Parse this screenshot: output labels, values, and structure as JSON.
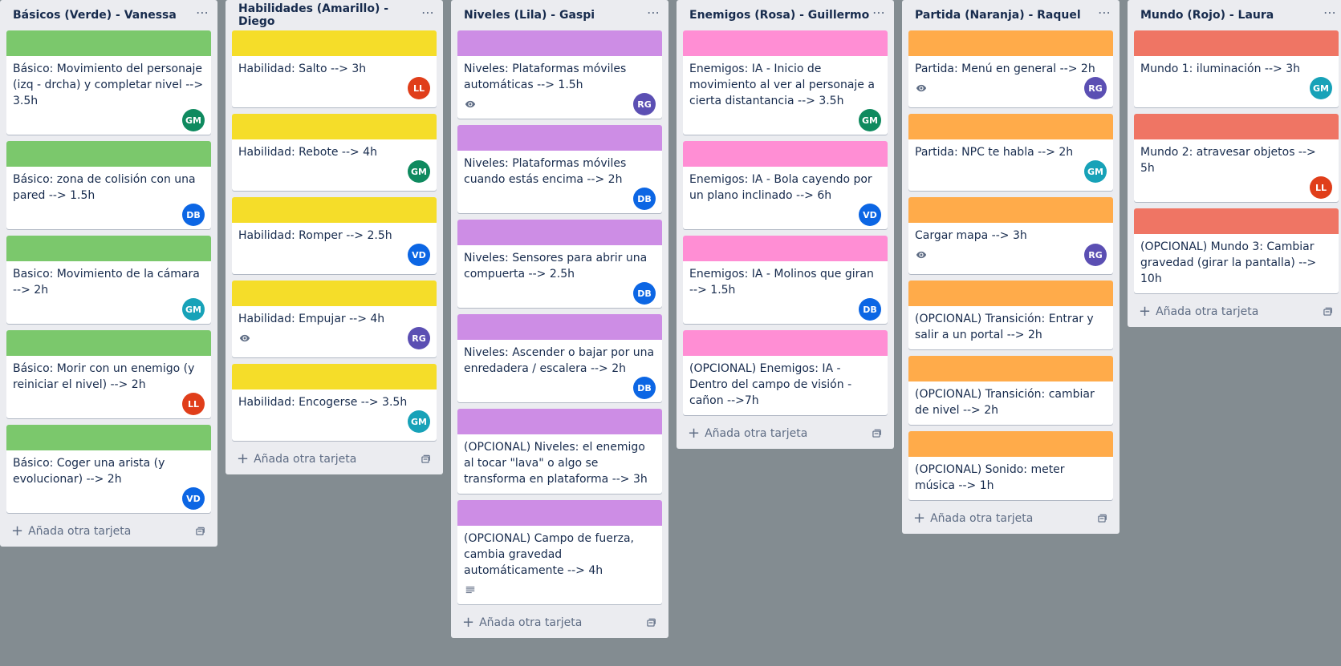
{
  "colors": {
    "green": "#61bd4f",
    "yellow": "#f2d600",
    "purple": "#c377e0",
    "pink": "#ff78cb",
    "orange": "#ff9f1a",
    "red": "#eb5a46"
  },
  "avatar_colors": {
    "GM": "#0f8a5f",
    "DB": "#0c66e4",
    "LL": "#e03e1a",
    "VD": "#0c66e4",
    "RG": "#5b4fb3"
  },
  "add_card_label": "Añada otra tarjeta",
  "lists": [
    {
      "title": "Básicos (Verde) - Vanessa",
      "color": "#7bc86c",
      "cards": [
        {
          "title": "Básico: Movimiento del personaje (izq - drcha) y completar nivel --> 3.5h",
          "member": "GM",
          "member_color": "#0f8a5f"
        },
        {
          "title": "Básico: zona de colisión con una pared --> 1.5h",
          "member": "DB",
          "member_color": "#0c66e4"
        },
        {
          "title": "Basico: Movimiento de la cámara --> 2h",
          "member": "GM",
          "member_color": "#17a2b8"
        },
        {
          "title": "Básico: Morir con un enemigo (y reiniciar el nivel) --> 2h",
          "member": "LL",
          "member_color": "#e03e1a"
        },
        {
          "title": "Básico: Coger una arista (y evolucionar) --> 2h",
          "member": "VD",
          "member_color": "#0c66e4"
        }
      ]
    },
    {
      "title": "Habilidades (Amarillo) - Diego",
      "color": "#f5dd29",
      "cards": [
        {
          "title": "Habilidad: Salto --> 3h",
          "member": "LL",
          "member_color": "#e03e1a"
        },
        {
          "title": "Habilidad: Rebote --> 4h",
          "member": "GM",
          "member_color": "#0f8a5f"
        },
        {
          "title": "Habilidad: Romper --> 2.5h",
          "member": "VD",
          "member_color": "#0c66e4"
        },
        {
          "title": "Habilidad: Empujar --> 4h",
          "member": "RG",
          "member_color": "#5b4fb3",
          "badge": "eye"
        },
        {
          "title": "Habilidad: Encogerse --> 3.5h",
          "member": "GM",
          "member_color": "#17a2b8"
        }
      ]
    },
    {
      "title": "Niveles (Lila) - Gaspi",
      "color": "#cd8de5",
      "cards": [
        {
          "title": "Niveles: Plataformas móviles automáticas --> 1.5h",
          "member": "RG",
          "member_color": "#5b4fb3",
          "badge": "eye"
        },
        {
          "title": "Niveles: Plataformas móviles cuando estás encima --> 2h",
          "member": "DB",
          "member_color": "#0c66e4"
        },
        {
          "title": "Niveles: Sensores para abrir una compuerta --> 2.5h",
          "member": "DB",
          "member_color": "#0c66e4"
        },
        {
          "title": "Niveles: Ascender o bajar por una enredadera / escalera --> 2h",
          "member": "DB",
          "member_color": "#0c66e4"
        },
        {
          "title": "(OPCIONAL) Niveles: el enemigo al tocar \"lava\" o algo se transforma en plataforma --> 3h",
          "member": "",
          "member_color": ""
        },
        {
          "title": "(OPCIONAL) Campo de fuerza, cambia gravedad automáticamente --> 4h",
          "member": "",
          "member_color": "",
          "badge": "description"
        }
      ]
    },
    {
      "title": "Enemigos (Rosa) - Guillermo",
      "color": "#ff8ed4",
      "cards": [
        {
          "title": "Enemigos: IA - Inicio de movimiento al ver al personaje a cierta distantancia --> 3.5h",
          "member": "GM",
          "member_color": "#0f8a5f"
        },
        {
          "title": "Enemigos: IA - Bola cayendo por un plano inclinado --> 6h",
          "member": "VD",
          "member_color": "#0c66e4"
        },
        {
          "title": "Enemigos: IA - Molinos que giran --> 1.5h",
          "member": "DB",
          "member_color": "#0c66e4"
        },
        {
          "title": "(OPCIONAL) Enemigos: IA - Dentro del campo de visión - cañon -->7h",
          "member": "",
          "member_color": ""
        }
      ]
    },
    {
      "title": "Partida (Naranja) - Raquel",
      "color": "#ffab4a",
      "cards": [
        {
          "title": "Partida: Menú en general --> 2h",
          "member": "RG",
          "member_color": "#5b4fb3",
          "badge": "eye"
        },
        {
          "title": "Partida: NPC te habla --> 2h",
          "member": "GM",
          "member_color": "#17a2b8"
        },
        {
          "title": "Cargar mapa --> 3h",
          "member": "RG",
          "member_color": "#5b4fb3",
          "badge": "eye"
        },
        {
          "title": "(OPCIONAL) Transición: Entrar y salir a un portal --> 2h",
          "member": "",
          "member_color": ""
        },
        {
          "title": "(OPCIONAL) Transición: cambiar de nivel --> 2h",
          "member": "",
          "member_color": ""
        },
        {
          "title": "(OPCIONAL) Sonido: meter música --> 1h",
          "member": "",
          "member_color": ""
        }
      ]
    },
    {
      "title": "Mundo (Rojo) - Laura",
      "color": "#ef7564",
      "cards": [
        {
          "title": "Mundo 1: iluminación --> 3h",
          "member": "GM",
          "member_color": "#17a2b8"
        },
        {
          "title": "Mundo 2: atravesar objetos --> 5h",
          "member": "LL",
          "member_color": "#e03e1a"
        },
        {
          "title": "(OPCIONAL) Mundo 3: Cambiar gravedad (girar la pantalla) --> 10h",
          "member": "",
          "member_color": ""
        }
      ]
    }
  ]
}
